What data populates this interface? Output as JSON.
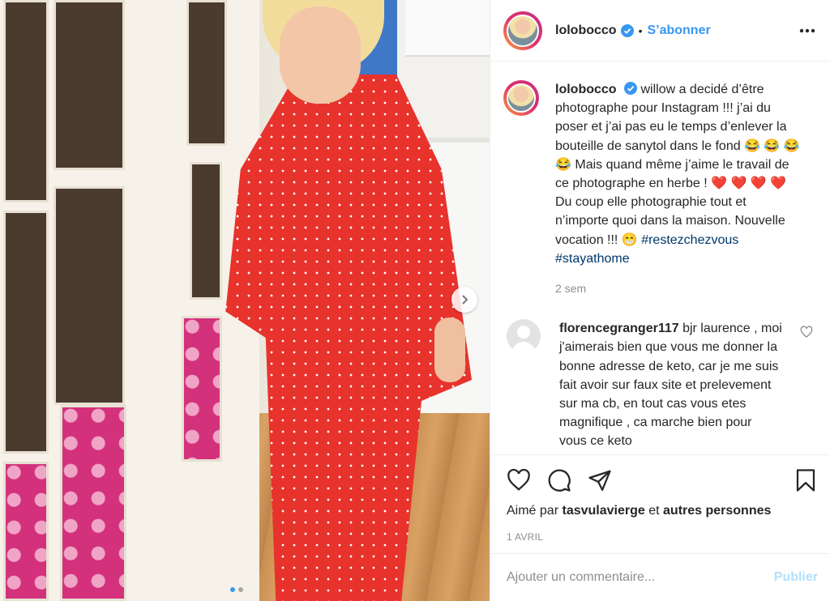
{
  "post": {
    "username": "lolobocco",
    "follow_label": "S’abonner",
    "dot": "•",
    "verified_icon": "verified-badge-icon",
    "more_icon": "more-options-icon",
    "carousel_icon": "chevron-right-icon",
    "carousel_dots": 2,
    "carousel_index": 0
  },
  "caption": {
    "username": "lolobocco",
    "text": "willow a decidé d’être photographe pour Instagram !!! j’ai du poser et j’ai pas eu le temps d’enlever la bouteille de sanytol dans le fond 😂 😂 😂 😂  Mais quand même j’aime le travail de ce photographe en herbe ! ❤️ ❤️ ❤️ ❤️  Du coup elle photographie tout et n’importe quoi dans la maison. Nouvelle vocation !!! 😁",
    "hashtags": [
      "#restezchezvous",
      "#stayathome"
    ],
    "time": "2 sem"
  },
  "comment": {
    "username": "florencegranger117",
    "text": "bjr laurence , moi j'aimerais bien que vous me donner la bonne adresse de keto, car je me suis fait avoir sur faux site et prelevement sur ma cb, en tout cas vous etes magnifique , ca marche bien pour vous ce keto"
  },
  "actions": {
    "like_icon": "heart-icon",
    "comment_icon": "comment-icon",
    "share_icon": "share-icon",
    "save_icon": "bookmark-icon"
  },
  "likes": {
    "prefix": "Aimé par",
    "user": "tasvulavierge",
    "connector": "et",
    "others": "autres personnes"
  },
  "date": "1 AVRIL",
  "add_comment": {
    "placeholder": "Ajouter un commentaire...",
    "publish_label": "Publier"
  },
  "colors": {
    "link_blue": "#3897f0",
    "hashtag": "#00376b",
    "muted": "#8e8e8e",
    "publish_disabled": "#b2dffc"
  }
}
